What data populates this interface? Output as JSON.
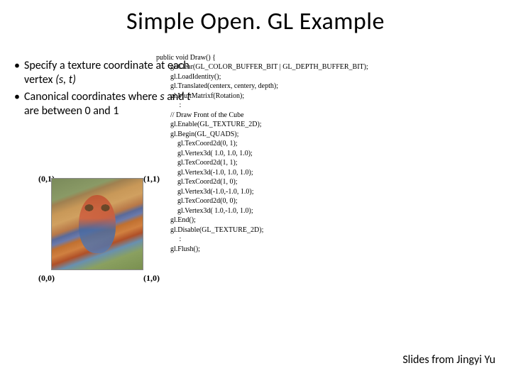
{
  "title": "Simple Open. GL Example",
  "bullets": [
    {
      "pre": "Specify a texture coordinate at each vertex ",
      "em": "(s, t)"
    },
    {
      "pre": "Canonical coordinates where ",
      "em": "s",
      "mid": " and ",
      "em2": "t",
      "post": " are between 0 and 1"
    }
  ],
  "code_lines": [
    "public void Draw() {",
    "        gl.Clear(GL_COLOR_BUFFER_BIT | GL_DEPTH_BUFFER_BIT);",
    "        gl.LoadIdentity();",
    "        gl.Translated(centerx, centery, depth);",
    "        gl.MultMatrixf(Rotation);",
    "             :",
    "        // Draw Front of the Cube",
    "        gl.Enable(GL_TEXTURE_2D);",
    "        gl.Begin(GL_QUADS);",
    "            gl.TexCoord2d(0, 1);",
    "            gl.Vertex3d( 1.0, 1.0, 1.0);",
    "            gl.TexCoord2d(1, 1);",
    "            gl.Vertex3d(-1.0, 1.0, 1.0);",
    "            gl.TexCoord2d(1, 0);",
    "            gl.Vertex3d(-1.0,-1.0, 1.0);",
    "            gl.TexCoord2d(0, 0);",
    "            gl.Vertex3d( 1.0,-1.0, 1.0);",
    "        gl.End();",
    "        gl.Disable(GL_TEXTURE_2D);",
    "             :",
    "        gl.Flush();"
  ],
  "coords": {
    "tl": "(0,1)",
    "tr": "(1,1)",
    "bl": "(0,0)",
    "br": "(1,0)"
  },
  "credit": "Slides from Jingyi Yu"
}
